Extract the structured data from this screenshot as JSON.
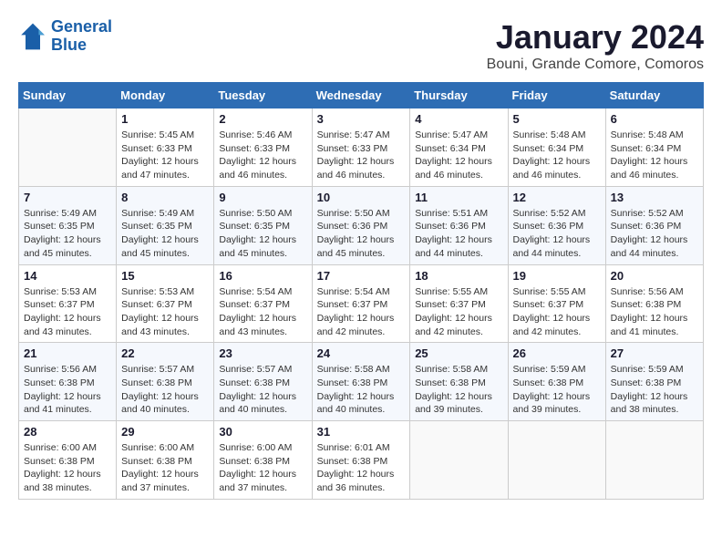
{
  "logo": {
    "line1": "General",
    "line2": "Blue"
  },
  "title": "January 2024",
  "subtitle": "Bouni, Grande Comore, Comoros",
  "days_of_week": [
    "Sunday",
    "Monday",
    "Tuesday",
    "Wednesday",
    "Thursday",
    "Friday",
    "Saturday"
  ],
  "weeks": [
    [
      {
        "day": "",
        "sunrise": "",
        "sunset": "",
        "daylight": ""
      },
      {
        "day": "1",
        "sunrise": "Sunrise: 5:45 AM",
        "sunset": "Sunset: 6:33 PM",
        "daylight": "Daylight: 12 hours and 47 minutes."
      },
      {
        "day": "2",
        "sunrise": "Sunrise: 5:46 AM",
        "sunset": "Sunset: 6:33 PM",
        "daylight": "Daylight: 12 hours and 46 minutes."
      },
      {
        "day": "3",
        "sunrise": "Sunrise: 5:47 AM",
        "sunset": "Sunset: 6:33 PM",
        "daylight": "Daylight: 12 hours and 46 minutes."
      },
      {
        "day": "4",
        "sunrise": "Sunrise: 5:47 AM",
        "sunset": "Sunset: 6:34 PM",
        "daylight": "Daylight: 12 hours and 46 minutes."
      },
      {
        "day": "5",
        "sunrise": "Sunrise: 5:48 AM",
        "sunset": "Sunset: 6:34 PM",
        "daylight": "Daylight: 12 hours and 46 minutes."
      },
      {
        "day": "6",
        "sunrise": "Sunrise: 5:48 AM",
        "sunset": "Sunset: 6:34 PM",
        "daylight": "Daylight: 12 hours and 46 minutes."
      }
    ],
    [
      {
        "day": "7",
        "sunrise": "Sunrise: 5:49 AM",
        "sunset": "Sunset: 6:35 PM",
        "daylight": "Daylight: 12 hours and 45 minutes."
      },
      {
        "day": "8",
        "sunrise": "Sunrise: 5:49 AM",
        "sunset": "Sunset: 6:35 PM",
        "daylight": "Daylight: 12 hours and 45 minutes."
      },
      {
        "day": "9",
        "sunrise": "Sunrise: 5:50 AM",
        "sunset": "Sunset: 6:35 PM",
        "daylight": "Daylight: 12 hours and 45 minutes."
      },
      {
        "day": "10",
        "sunrise": "Sunrise: 5:50 AM",
        "sunset": "Sunset: 6:36 PM",
        "daylight": "Daylight: 12 hours and 45 minutes."
      },
      {
        "day": "11",
        "sunrise": "Sunrise: 5:51 AM",
        "sunset": "Sunset: 6:36 PM",
        "daylight": "Daylight: 12 hours and 44 minutes."
      },
      {
        "day": "12",
        "sunrise": "Sunrise: 5:52 AM",
        "sunset": "Sunset: 6:36 PM",
        "daylight": "Daylight: 12 hours and 44 minutes."
      },
      {
        "day": "13",
        "sunrise": "Sunrise: 5:52 AM",
        "sunset": "Sunset: 6:36 PM",
        "daylight": "Daylight: 12 hours and 44 minutes."
      }
    ],
    [
      {
        "day": "14",
        "sunrise": "Sunrise: 5:53 AM",
        "sunset": "Sunset: 6:37 PM",
        "daylight": "Daylight: 12 hours and 43 minutes."
      },
      {
        "day": "15",
        "sunrise": "Sunrise: 5:53 AM",
        "sunset": "Sunset: 6:37 PM",
        "daylight": "Daylight: 12 hours and 43 minutes."
      },
      {
        "day": "16",
        "sunrise": "Sunrise: 5:54 AM",
        "sunset": "Sunset: 6:37 PM",
        "daylight": "Daylight: 12 hours and 43 minutes."
      },
      {
        "day": "17",
        "sunrise": "Sunrise: 5:54 AM",
        "sunset": "Sunset: 6:37 PM",
        "daylight": "Daylight: 12 hours and 42 minutes."
      },
      {
        "day": "18",
        "sunrise": "Sunrise: 5:55 AM",
        "sunset": "Sunset: 6:37 PM",
        "daylight": "Daylight: 12 hours and 42 minutes."
      },
      {
        "day": "19",
        "sunrise": "Sunrise: 5:55 AM",
        "sunset": "Sunset: 6:37 PM",
        "daylight": "Daylight: 12 hours and 42 minutes."
      },
      {
        "day": "20",
        "sunrise": "Sunrise: 5:56 AM",
        "sunset": "Sunset: 6:38 PM",
        "daylight": "Daylight: 12 hours and 41 minutes."
      }
    ],
    [
      {
        "day": "21",
        "sunrise": "Sunrise: 5:56 AM",
        "sunset": "Sunset: 6:38 PM",
        "daylight": "Daylight: 12 hours and 41 minutes."
      },
      {
        "day": "22",
        "sunrise": "Sunrise: 5:57 AM",
        "sunset": "Sunset: 6:38 PM",
        "daylight": "Daylight: 12 hours and 40 minutes."
      },
      {
        "day": "23",
        "sunrise": "Sunrise: 5:57 AM",
        "sunset": "Sunset: 6:38 PM",
        "daylight": "Daylight: 12 hours and 40 minutes."
      },
      {
        "day": "24",
        "sunrise": "Sunrise: 5:58 AM",
        "sunset": "Sunset: 6:38 PM",
        "daylight": "Daylight: 12 hours and 40 minutes."
      },
      {
        "day": "25",
        "sunrise": "Sunrise: 5:58 AM",
        "sunset": "Sunset: 6:38 PM",
        "daylight": "Daylight: 12 hours and 39 minutes."
      },
      {
        "day": "26",
        "sunrise": "Sunrise: 5:59 AM",
        "sunset": "Sunset: 6:38 PM",
        "daylight": "Daylight: 12 hours and 39 minutes."
      },
      {
        "day": "27",
        "sunrise": "Sunrise: 5:59 AM",
        "sunset": "Sunset: 6:38 PM",
        "daylight": "Daylight: 12 hours and 38 minutes."
      }
    ],
    [
      {
        "day": "28",
        "sunrise": "Sunrise: 6:00 AM",
        "sunset": "Sunset: 6:38 PM",
        "daylight": "Daylight: 12 hours and 38 minutes."
      },
      {
        "day": "29",
        "sunrise": "Sunrise: 6:00 AM",
        "sunset": "Sunset: 6:38 PM",
        "daylight": "Daylight: 12 hours and 37 minutes."
      },
      {
        "day": "30",
        "sunrise": "Sunrise: 6:00 AM",
        "sunset": "Sunset: 6:38 PM",
        "daylight": "Daylight: 12 hours and 37 minutes."
      },
      {
        "day": "31",
        "sunrise": "Sunrise: 6:01 AM",
        "sunset": "Sunset: 6:38 PM",
        "daylight": "Daylight: 12 hours and 36 minutes."
      },
      {
        "day": "",
        "sunrise": "",
        "sunset": "",
        "daylight": ""
      },
      {
        "day": "",
        "sunrise": "",
        "sunset": "",
        "daylight": ""
      },
      {
        "day": "",
        "sunrise": "",
        "sunset": "",
        "daylight": ""
      }
    ]
  ]
}
